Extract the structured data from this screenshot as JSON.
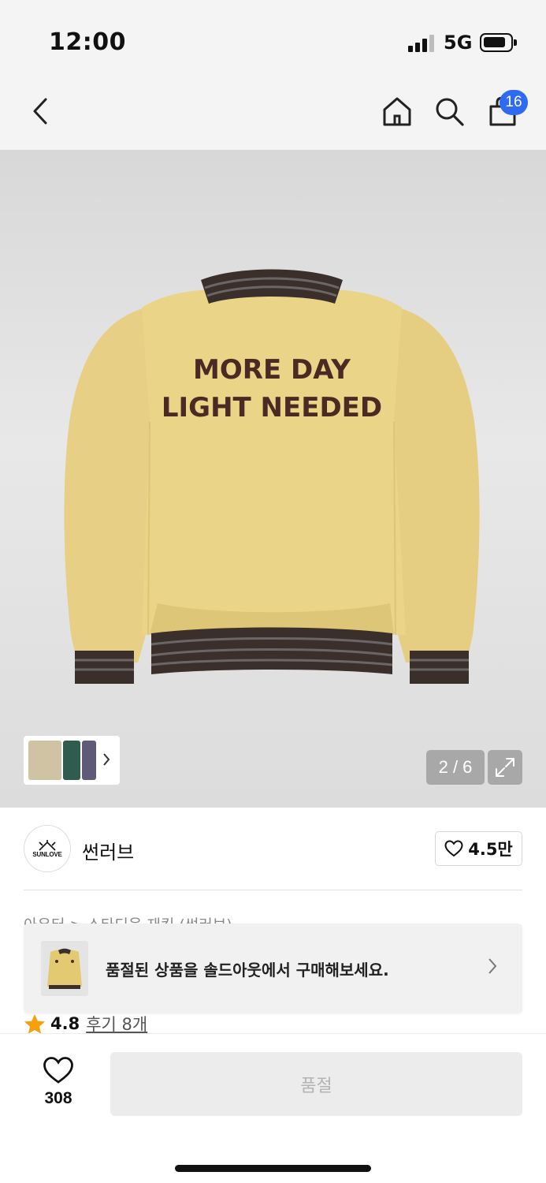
{
  "status_bar": {
    "time": "12:00",
    "network": "5G"
  },
  "nav": {
    "cart_count": "16",
    "icons": [
      "back-icon",
      "home-icon",
      "search-icon",
      "cart-icon"
    ]
  },
  "product_image": {
    "print_line1": "MORE DAY",
    "print_line2": "LIGHT NEEDED",
    "counter": "2 / 6",
    "colors": {
      "body": "#e9d38a",
      "rib": "#3b2f2c",
      "print": "#4a2a22"
    }
  },
  "brand": {
    "logo_text": "SUNLOVE",
    "name": "썬러브",
    "likes": "4.5만"
  },
  "breadcrumb": "아우터 > 스타디움 재킷 (썬러브)",
  "soldout_banner": {
    "text": "품절된 상품을 솔드아웃에서 구매해보세요."
  },
  "rating": {
    "value": "4.8",
    "reviews": "후기 8개"
  },
  "bottom_bar": {
    "wish_count": "308",
    "buy_label": "품절"
  }
}
